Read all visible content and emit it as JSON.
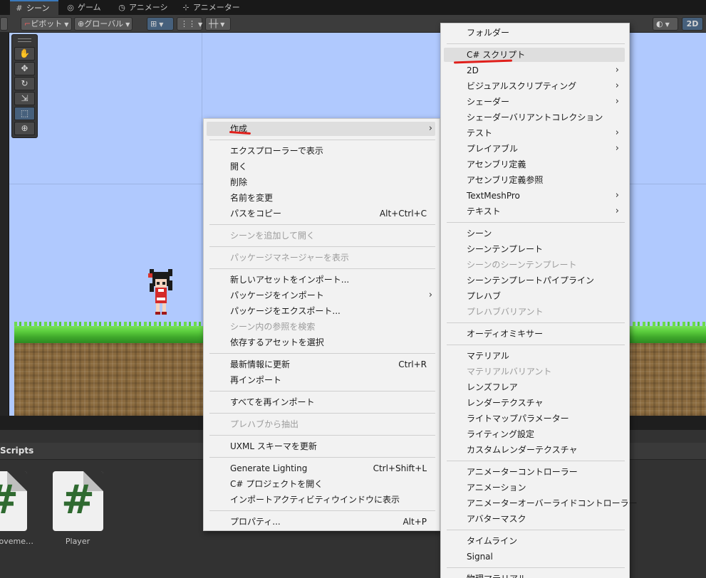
{
  "tabs": [
    {
      "label": "シーン",
      "icon": "grid-icon",
      "active": true
    },
    {
      "label": "ゲーム",
      "icon": "gamepad-icon",
      "active": false
    },
    {
      "label": "アニメーション",
      "icon": "clock-icon",
      "active": false
    },
    {
      "label": "アニメーター",
      "icon": "animator-icon",
      "active": false
    }
  ],
  "toolbar": {
    "pivot": "ピボット",
    "global": "グローバル",
    "mode_2d": "2D"
  },
  "project": {
    "folder": "Scripts",
    "assets": [
      {
        "label": "Moveme…",
        "icon": "csharp-script-icon"
      },
      {
        "label": "Player",
        "icon": "csharp-script-icon"
      }
    ]
  },
  "context_menu": {
    "items": [
      {
        "label": "作成",
        "submenu": true,
        "highlighted": true
      },
      {
        "separator": true
      },
      {
        "label": "エクスプローラーで表示"
      },
      {
        "label": "開く"
      },
      {
        "label": "削除"
      },
      {
        "label": "名前を変更"
      },
      {
        "label": "パスをコピー",
        "shortcut": "Alt+Ctrl+C"
      },
      {
        "separator": true
      },
      {
        "label": "シーンを追加して開く",
        "disabled": true
      },
      {
        "separator": true
      },
      {
        "label": "パッケージマネージャーを表示",
        "disabled": true
      },
      {
        "separator": true
      },
      {
        "label": "新しいアセットをインポート..."
      },
      {
        "label": "パッケージをインポート",
        "submenu": true
      },
      {
        "label": "パッケージをエクスポート..."
      },
      {
        "label": "シーン内の参照を検索",
        "disabled": true
      },
      {
        "label": "依存するアセットを選択"
      },
      {
        "separator": true
      },
      {
        "label": "最新情報に更新",
        "shortcut": "Ctrl+R"
      },
      {
        "label": "再インポート"
      },
      {
        "separator": true
      },
      {
        "label": "すべてを再インポート"
      },
      {
        "separator": true
      },
      {
        "label": "プレハブから抽出",
        "disabled": true
      },
      {
        "separator": true
      },
      {
        "label": "UXML スキーマを更新"
      },
      {
        "separator": true
      },
      {
        "label": "Generate Lighting",
        "shortcut": "Ctrl+Shift+L"
      },
      {
        "label": "C# プロジェクトを開く"
      },
      {
        "label": "インポートアクティビティウインドウに表示"
      },
      {
        "separator": true
      },
      {
        "label": "プロパティ...",
        "shortcut": "Alt+P"
      }
    ]
  },
  "create_submenu": {
    "items": [
      {
        "label": "フォルダー"
      },
      {
        "separator": true
      },
      {
        "label": "C# スクリプト",
        "highlighted": true
      },
      {
        "label": "2D",
        "submenu": true
      },
      {
        "label": "ビジュアルスクリプティング",
        "submenu": true
      },
      {
        "label": "シェーダー",
        "submenu": true
      },
      {
        "label": "シェーダーバリアントコレクション"
      },
      {
        "label": "テスト",
        "submenu": true
      },
      {
        "label": "プレイアブル",
        "submenu": true
      },
      {
        "label": "アセンブリ定義"
      },
      {
        "label": "アセンブリ定義参照"
      },
      {
        "label": "TextMeshPro",
        "submenu": true
      },
      {
        "label": "テキスト",
        "submenu": true
      },
      {
        "separator": true
      },
      {
        "label": "シーン"
      },
      {
        "label": "シーンテンプレート"
      },
      {
        "label": "シーンのシーンテンプレート",
        "disabled": true
      },
      {
        "label": "シーンテンプレートパイプライン"
      },
      {
        "label": "プレハブ"
      },
      {
        "label": "プレハブバリアント",
        "disabled": true
      },
      {
        "separator": true
      },
      {
        "label": "オーディオミキサー"
      },
      {
        "separator": true
      },
      {
        "label": "マテリアル"
      },
      {
        "label": "マテリアルバリアント",
        "disabled": true
      },
      {
        "label": "レンズフレア"
      },
      {
        "label": "レンダーテクスチャ"
      },
      {
        "label": "ライトマップパラメーター"
      },
      {
        "label": "ライティング設定"
      },
      {
        "label": "カスタムレンダーテクスチャ"
      },
      {
        "separator": true
      },
      {
        "label": "アニメーターコントローラー"
      },
      {
        "label": "アニメーション"
      },
      {
        "label": "アニメーターオーバーライドコントローラー"
      },
      {
        "label": "アバターマスク"
      },
      {
        "separator": true
      },
      {
        "label": "タイムライン"
      },
      {
        "label": "Signal"
      },
      {
        "separator": true
      },
      {
        "label": "物理マテリアル"
      }
    ]
  },
  "colors": {
    "scene_sky": "#b0c9fe",
    "menu_bg": "#f2f2f2",
    "annotation_red": "#e0201c",
    "selection_blue": "#46607c"
  }
}
